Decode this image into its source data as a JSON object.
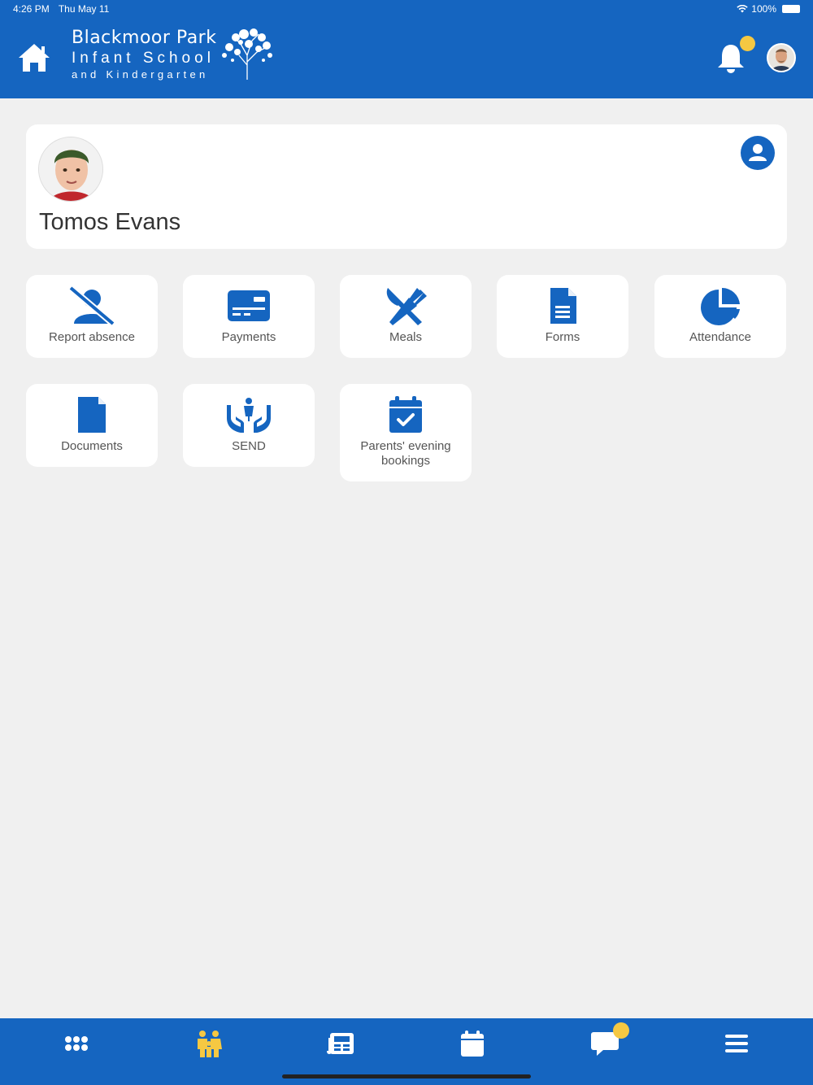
{
  "status_bar": {
    "time": "4:26 PM",
    "date": "Thu May 11",
    "battery": "100%"
  },
  "header": {
    "logo": {
      "line1": "Blackmoor Park",
      "line2": "Infant School",
      "line3": "and Kindergarten"
    },
    "notification_badge_color": "#f5c842"
  },
  "profile": {
    "child_name": "Tomos Evans"
  },
  "tiles": [
    {
      "label": "Report absence",
      "icon": "user-slash-icon"
    },
    {
      "label": "Payments",
      "icon": "credit-card-icon"
    },
    {
      "label": "Meals",
      "icon": "utensils-icon"
    },
    {
      "label": "Forms",
      "icon": "document-text-icon"
    },
    {
      "label": "Attendance",
      "icon": "pie-chart-icon"
    },
    {
      "label": "Documents",
      "icon": "file-icon"
    },
    {
      "label": "SEND",
      "icon": "hands-child-icon"
    },
    {
      "label": "Parents' evening bookings",
      "icon": "calendar-check-icon"
    }
  ],
  "bottom_nav": [
    {
      "name": "apps",
      "icon": "grid-icon"
    },
    {
      "name": "family",
      "icon": "family-icon",
      "active": true
    },
    {
      "name": "news",
      "icon": "newspaper-icon"
    },
    {
      "name": "calendar",
      "icon": "calendar-icon"
    },
    {
      "name": "messages",
      "icon": "chat-icon"
    },
    {
      "name": "menu",
      "icon": "hamburger-icon"
    }
  ],
  "colors": {
    "primary": "#1565c0",
    "accent": "#f5c842",
    "background": "#f0f0f0"
  }
}
